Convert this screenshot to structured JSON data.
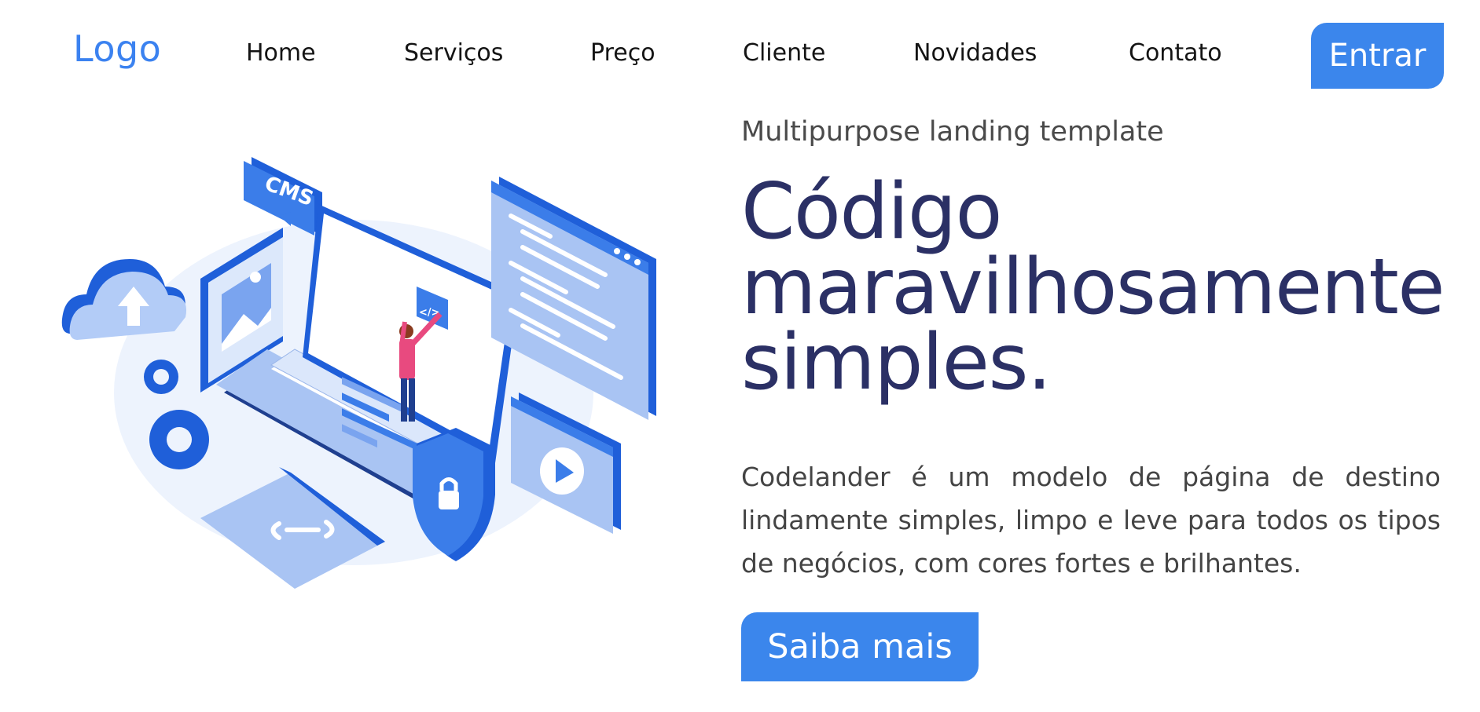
{
  "header": {
    "logo": "Logo",
    "nav": [
      {
        "label": "Home"
      },
      {
        "label": "Serviços"
      },
      {
        "label": "Preço"
      },
      {
        "label": "Cliente"
      },
      {
        "label": "Novidades"
      },
      {
        "label": "Contato"
      }
    ],
    "login_label": "Entrar"
  },
  "hero": {
    "eyebrow": "Multipurpose landing template",
    "headline": [
      "Código",
      "maravilhosamente",
      "simples."
    ],
    "description": "Codelander é um modelo de página de destino lindamente simples, limpo e leve para todos os tipos de negócios, com cores fortes e brilhantes.",
    "cta_label": "Saiba mais",
    "illustration": {
      "cms_badge": "CMS",
      "code_tag": "</>",
      "icons": [
        "cloud-upload-icon",
        "image-frame-icon",
        "gear-icon",
        "gear-icon",
        "laptop-icon",
        "person-icon",
        "code-window-icon",
        "video-player-icon",
        "shield-lock-icon",
        "code-card-icon"
      ]
    }
  },
  "colors": {
    "accent": "#3b86ec",
    "headline": "#2b3065",
    "logo": "#3b82f0",
    "illustration_dark": "#1f5fd9",
    "illustration_light": "#b3ccf7",
    "person_shirt": "#e84a7f"
  }
}
